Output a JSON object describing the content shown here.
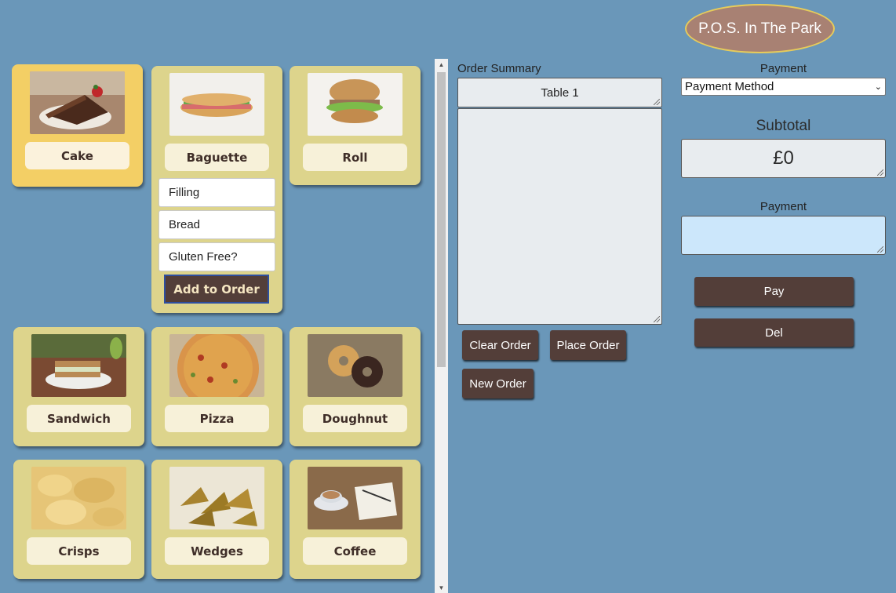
{
  "brand": {
    "title": "P.O.S. In The Park"
  },
  "products": [
    {
      "name": "Cake",
      "image": "cake-photo"
    },
    {
      "name": "Baguette",
      "image": "baguette-photo"
    },
    {
      "name": "Roll",
      "image": "roll-photo"
    },
    {
      "name": "Sandwich",
      "image": "sandwich-photo"
    },
    {
      "name": "Pizza",
      "image": "pizza-photo"
    },
    {
      "name": "Doughnut",
      "image": "doughnut-photo"
    },
    {
      "name": "Crisps",
      "image": "crisps-photo"
    },
    {
      "name": "Wedges",
      "image": "wedges-photo"
    },
    {
      "name": "Coffee",
      "image": "coffee-photo"
    }
  ],
  "baguette_options": {
    "filling": "Filling",
    "bread": "Bread",
    "gluten_free": "Gluten Free?",
    "add_to_order": "Add to Order"
  },
  "order": {
    "summary_label": "Order Summary",
    "table": "Table 1",
    "items_text": "",
    "clear": "Clear Order",
    "place": "Place Order",
    "new": "New Order"
  },
  "payment": {
    "heading": "Payment",
    "method_selected": "Payment Method",
    "subtotal_label": "Subtotal",
    "subtotal_value": "£0",
    "payment_label": "Payment",
    "payment_value": "",
    "pay": "Pay",
    "del": "Del"
  },
  "colors": {
    "background": "#6a97b9",
    "card": "#ddd48c",
    "card_active": "#f3cf65",
    "button": "#533e39",
    "brand_badge": "#a88173"
  }
}
